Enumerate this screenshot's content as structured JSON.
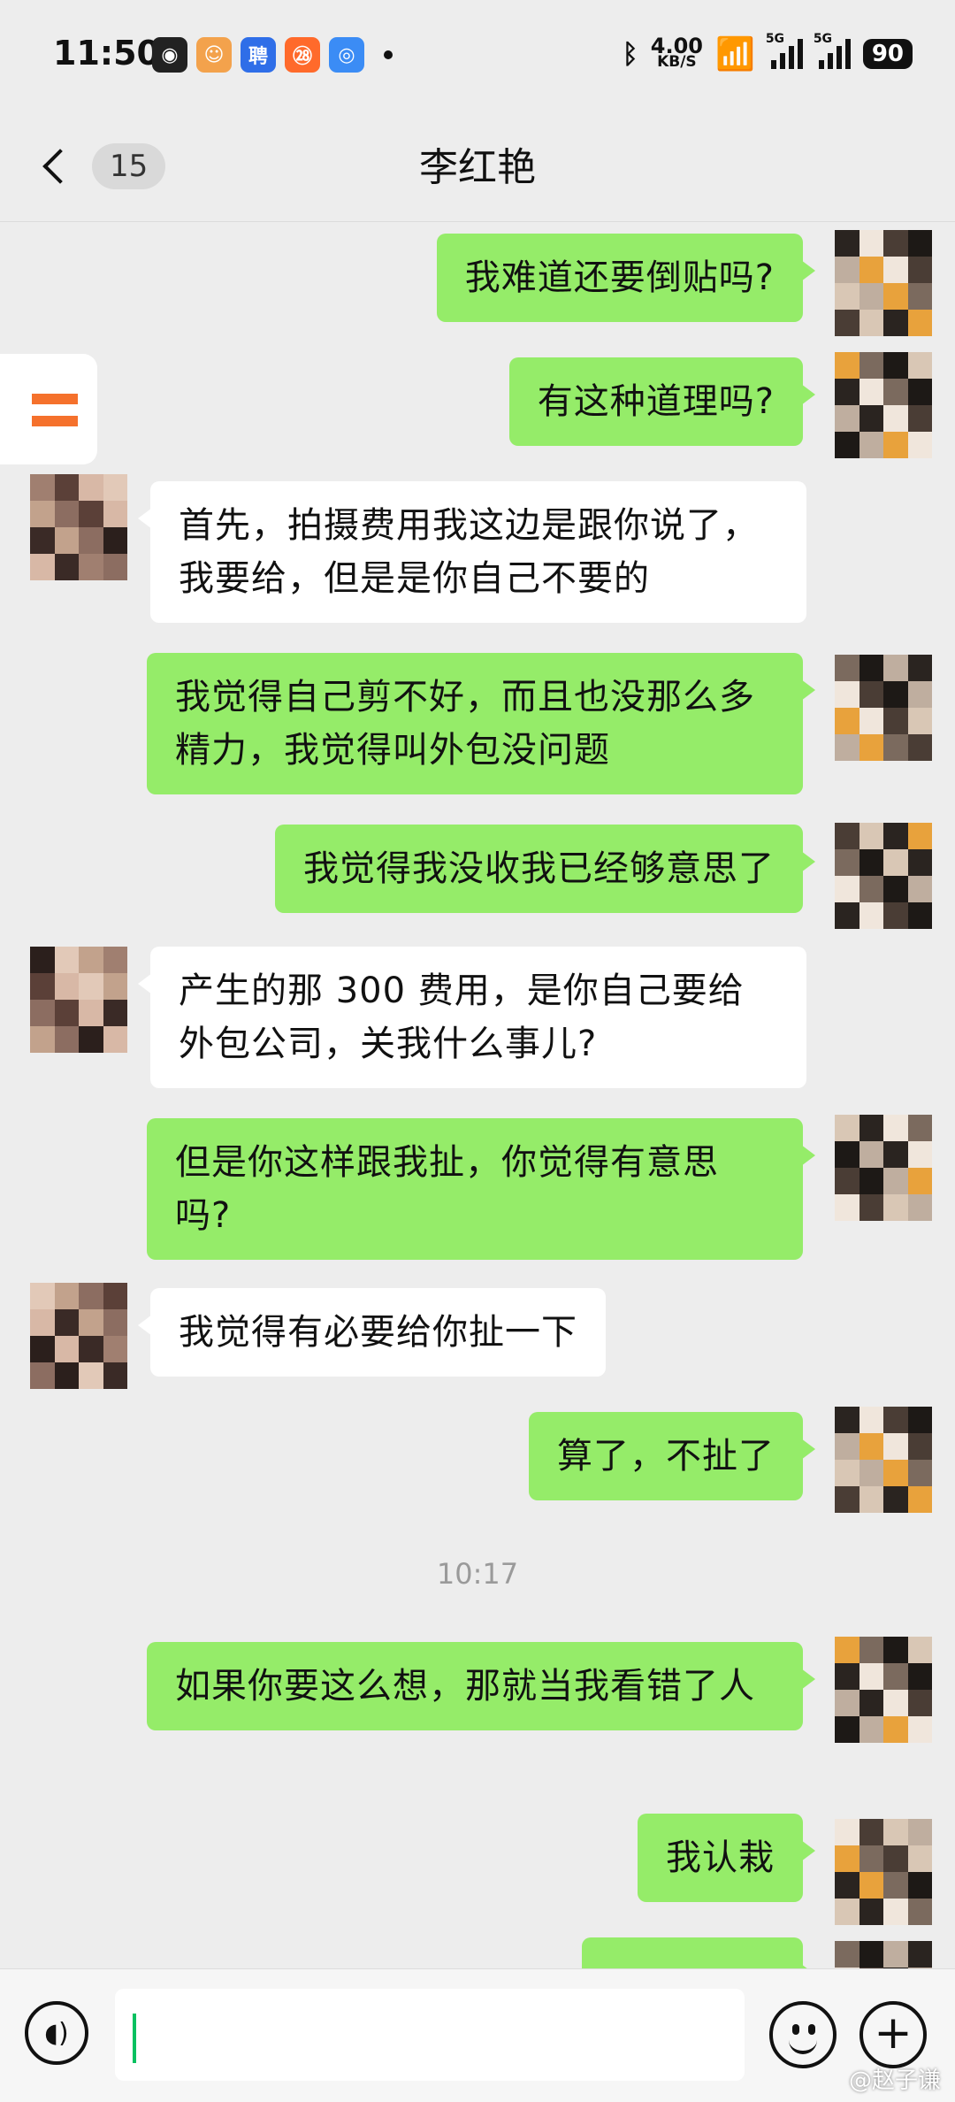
{
  "status_bar": {
    "time": "11:50",
    "app_icons": [
      "panda-app-icon",
      "cat-app-icon",
      "zhipin-app-icon",
      "boss-app-icon",
      "browser-app-icon"
    ],
    "app_icon_glyphs": [
      "◉",
      "☺",
      "聘",
      "㉘",
      "◎"
    ],
    "app_icon_colors": [
      "#222222",
      "#f3a24c",
      "#2f6ee8",
      "#ff6a2b",
      "#3b8cf5"
    ],
    "net_speed_value": "4.00",
    "net_speed_unit": "KB/S",
    "network_1": "5G",
    "network_2": "5G",
    "battery": "90"
  },
  "header": {
    "back_label": "<",
    "unread_count": "15",
    "title": "李红艳"
  },
  "messages": [
    {
      "from": "me",
      "text": "我难道还要倒贴吗?"
    },
    {
      "from": "me",
      "text": "有这种道理吗?"
    },
    {
      "from": "them",
      "text": "首先，拍摄费用我这边是跟你说了，我要给，但是是你自己不要的"
    },
    {
      "from": "me",
      "text": "我觉得自己剪不好，而且也没那么多精力，我觉得叫外包没问题"
    },
    {
      "from": "me",
      "text": "我觉得我没收我已经够意思了"
    },
    {
      "from": "them",
      "text": "产生的那 300 费用，是你自己要给外包公司，关我什么事儿?"
    },
    {
      "from": "me",
      "text": "但是你这样跟我扯，你觉得有意思吗?"
    },
    {
      "from": "them",
      "text": "我觉得有必要给你扯一下"
    },
    {
      "from": "me",
      "text": "算了，不扯了"
    },
    {
      "from": "me",
      "text": "如果你要这么想，那就当我看错了人"
    },
    {
      "from": "me",
      "text": "我认栽"
    },
    {
      "from": "me",
      "text": ""
    }
  ],
  "timestamp": "10:17",
  "input": {
    "value": "",
    "voice_icon": "voice-icon",
    "emoji_icon": "emoji-icon",
    "plus_icon": "plus-icon"
  },
  "watermark": "@赵子谦",
  "colors": {
    "my_bubble": "#95ec69",
    "their_bubble": "#ffffff",
    "background": "#ededed"
  }
}
